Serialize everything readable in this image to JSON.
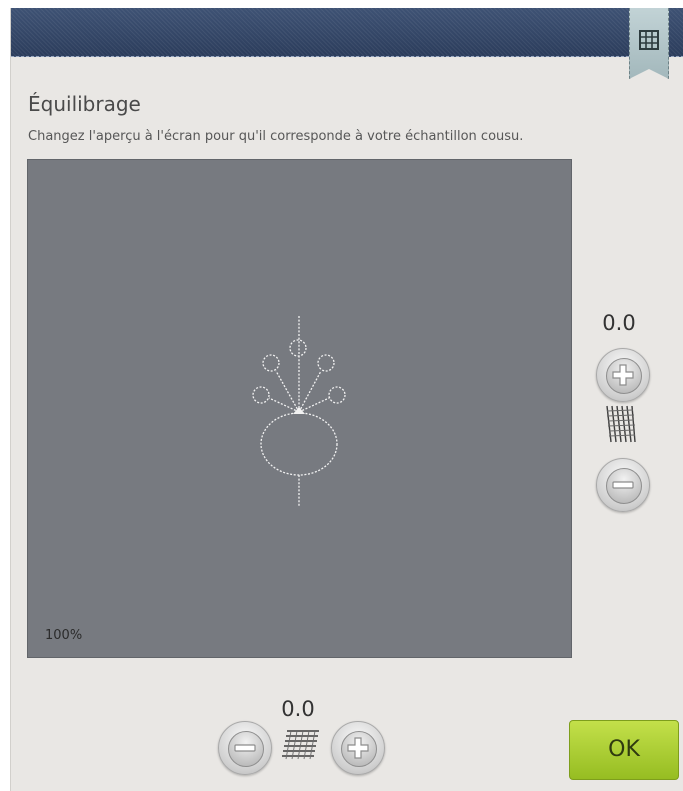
{
  "header": {
    "corner_tab_icon": "stitch-grid-icon"
  },
  "dialog": {
    "title": "Équilibrage",
    "subtitle": "Changez l'aperçu à l'écran pour qu'il corresponde à votre échantillon cousu."
  },
  "preview": {
    "zoom_label": "100%",
    "design_icon": "flower-stitch-design"
  },
  "vertical_balance": {
    "value": "0.0",
    "increase_icon": "plus-icon",
    "decrease_icon": "minus-icon",
    "indicator_icon": "vertical-fabric-icon"
  },
  "horizontal_balance": {
    "value": "0.0",
    "increase_icon": "plus-icon",
    "decrease_icon": "minus-icon",
    "indicator_icon": "horizontal-fabric-icon"
  },
  "actions": {
    "ok_label": "OK",
    "ok_color": "#a8cc2e"
  }
}
